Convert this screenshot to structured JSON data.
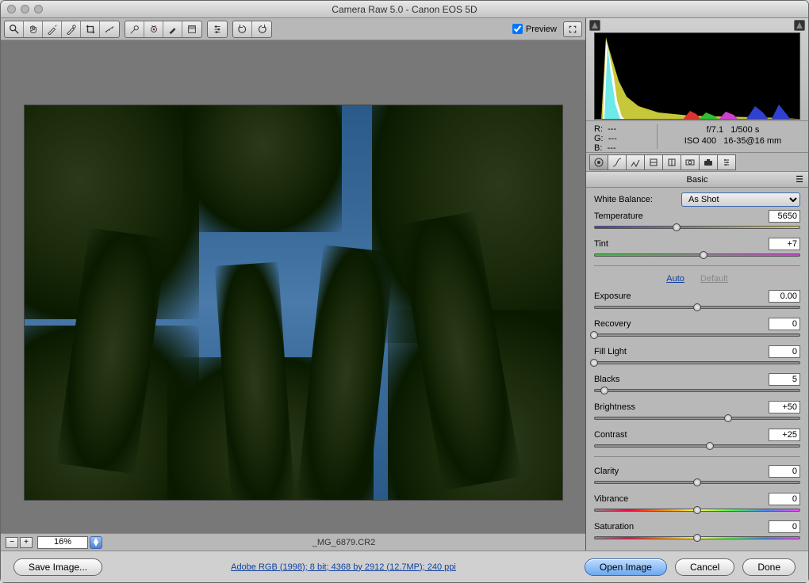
{
  "window": {
    "title": "Camera Raw 5.0  -  Canon EOS 5D"
  },
  "toolbar": {
    "preview_label": "Preview",
    "preview_checked": true
  },
  "image": {
    "filename": "_MG_6879.CR2",
    "zoom": "16%"
  },
  "meta": {
    "r_label": "R:",
    "g_label": "G:",
    "b_label": "B:",
    "r_val": "---",
    "g_val": "---",
    "b_val": "---",
    "aperture": "f/7.1",
    "shutter": "1/500 s",
    "iso": "ISO 400",
    "lens": "16-35@16 mm"
  },
  "panel": {
    "title": "Basic",
    "wb_label": "White Balance:",
    "wb_value": "As Shot",
    "auto": "Auto",
    "default": "Default",
    "sliders": {
      "temperature": {
        "label": "Temperature",
        "value": "5650",
        "pos": 40
      },
      "tint": {
        "label": "Tint",
        "value": "+7",
        "pos": 53
      },
      "exposure": {
        "label": "Exposure",
        "value": "0.00",
        "pos": 50
      },
      "recovery": {
        "label": "Recovery",
        "value": "0",
        "pos": 0
      },
      "filllight": {
        "label": "Fill Light",
        "value": "0",
        "pos": 0
      },
      "blacks": {
        "label": "Blacks",
        "value": "5",
        "pos": 5
      },
      "brightness": {
        "label": "Brightness",
        "value": "+50",
        "pos": 65
      },
      "contrast": {
        "label": "Contrast",
        "value": "+25",
        "pos": 56
      },
      "clarity": {
        "label": "Clarity",
        "value": "0",
        "pos": 50
      },
      "vibrance": {
        "label": "Vibrance",
        "value": "0",
        "pos": 50
      },
      "saturation": {
        "label": "Saturation",
        "value": "0",
        "pos": 50
      }
    }
  },
  "footer": {
    "save_image": "Save Image...",
    "workflow_link": "Adobe RGB (1998); 8 bit; 4368 by 2912 (12.7MP); 240 ppi",
    "open_image": "Open Image",
    "cancel": "Cancel",
    "done": "Done"
  },
  "chart_data": {
    "type": "histogram",
    "title": "RGB Histogram",
    "xlabel": "",
    "ylabel": "",
    "xlim": [
      0,
      255
    ],
    "note": "Large spike near shadows (dark foliage), small color bumps in midtones and highlights (sky blues, foliage greens)."
  }
}
